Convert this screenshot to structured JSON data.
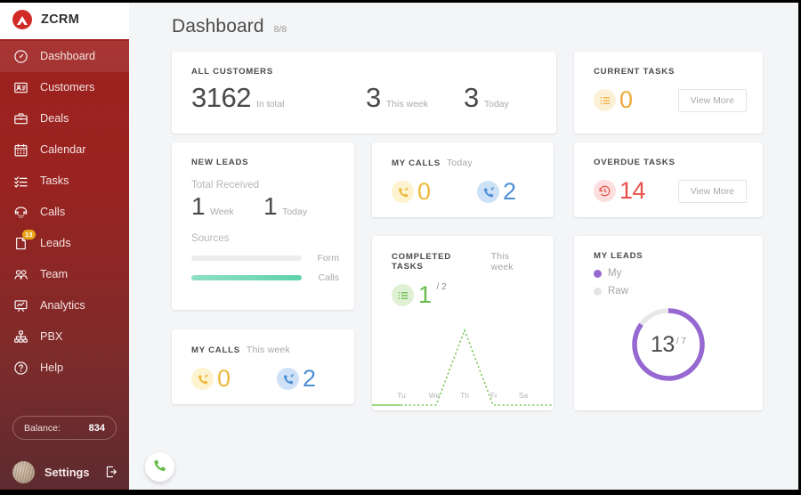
{
  "brand": {
    "name": "ZCRM",
    "logo_icon": "zcrm-logo-icon"
  },
  "sidebar": {
    "items": [
      {
        "label": "Dashboard",
        "icon": "gauge-icon",
        "active": true
      },
      {
        "label": "Customers",
        "icon": "contact-card-icon",
        "active": false
      },
      {
        "label": "Deals",
        "icon": "briefcase-icon",
        "active": false
      },
      {
        "label": "Calendar",
        "icon": "calendar-icon",
        "active": false
      },
      {
        "label": "Tasks",
        "icon": "checklist-icon",
        "active": false
      },
      {
        "label": "Calls",
        "icon": "telephone-icon",
        "active": false
      },
      {
        "label": "Leads",
        "icon": "lead-page-icon",
        "active": false,
        "badge": "13"
      },
      {
        "label": "Team",
        "icon": "people-icon",
        "active": false
      },
      {
        "label": "Analytics",
        "icon": "presentation-chart-icon",
        "active": false
      },
      {
        "label": "PBX",
        "icon": "sitemap-icon",
        "active": false
      },
      {
        "label": "Help",
        "icon": "question-circle-icon",
        "active": false
      }
    ],
    "balance": {
      "label": "Balance:",
      "value": "834"
    },
    "settings": {
      "label": "Settings",
      "logout_icon": "logout-icon",
      "avatar_icon": "user-avatar"
    }
  },
  "header": {
    "title": "Dashboard",
    "count": "8/8"
  },
  "cards": {
    "all_customers": {
      "title": "All Customers",
      "metrics": [
        {
          "value": "3162",
          "label": "In total"
        },
        {
          "value": "3",
          "label": "This week"
        },
        {
          "value": "3",
          "label": "Today"
        }
      ]
    },
    "current_tasks": {
      "title": "Current Tasks",
      "value": "0",
      "icon": "task-list-icon",
      "accent": "#eda93b",
      "button": "View More"
    },
    "new_leads": {
      "title": "New Leads",
      "received_label": "Total Received",
      "metrics": [
        {
          "value": "1",
          "label": "Week"
        },
        {
          "value": "1",
          "label": "Today"
        }
      ],
      "sources_label": "Sources",
      "sources": [
        {
          "label": "Form",
          "percent": 100,
          "color": "#ececec"
        },
        {
          "label": "Calls",
          "percent": 100,
          "color": "#6fd6b4"
        }
      ]
    },
    "my_calls_today": {
      "title": "My Calls",
      "period": "Today",
      "stats": [
        {
          "value": "0",
          "icon": "call-outgoing-icon",
          "accent": "#edb93b",
          "bg": "#fdf3cf"
        },
        {
          "value": "2",
          "icon": "call-incoming-icon",
          "accent": "#4d8fd6",
          "bg": "#cfe1f6"
        }
      ]
    },
    "overdue_tasks": {
      "title": "Overdue Tasks",
      "value": "14",
      "icon": "clock-rewind-icon",
      "accent": "#e8514b",
      "button": "View More"
    },
    "completed_tasks": {
      "title": "Completed Tasks",
      "period": "This week",
      "value": "1",
      "denominator": "/ 2",
      "icon": "task-list-icon",
      "accent": "#63bb46"
    },
    "my_leads": {
      "title": "My Leads",
      "legend": [
        {
          "label": "My",
          "color": "#9768d1"
        },
        {
          "label": "Raw",
          "color": "#e4e4e4"
        }
      ],
      "value": "13",
      "denominator": "/ 7"
    },
    "my_calls_week": {
      "title": "My Calls",
      "period": "This week",
      "stats": [
        {
          "value": "0",
          "icon": "call-outgoing-icon",
          "accent": "#edb93b",
          "bg": "#fdf3cf"
        },
        {
          "value": "2",
          "icon": "call-incoming-icon",
          "accent": "#4d8fd6",
          "bg": "#cfe1f6"
        }
      ]
    }
  },
  "fab": {
    "icon": "phone-call-icon",
    "color": "#63bb46"
  },
  "chart_data": {
    "type": "line",
    "title": "Completed Tasks",
    "subtitle": "This week",
    "categories": [
      "Tu",
      "We",
      "Th",
      "Fr",
      "Sa"
    ],
    "values": [
      0,
      0,
      1,
      0,
      0
    ],
    "ylim": [
      0,
      1
    ],
    "xlabel": "",
    "ylabel": "",
    "grid": false,
    "legend": "none",
    "line_style": "dashed",
    "color": "#7fc95a"
  }
}
